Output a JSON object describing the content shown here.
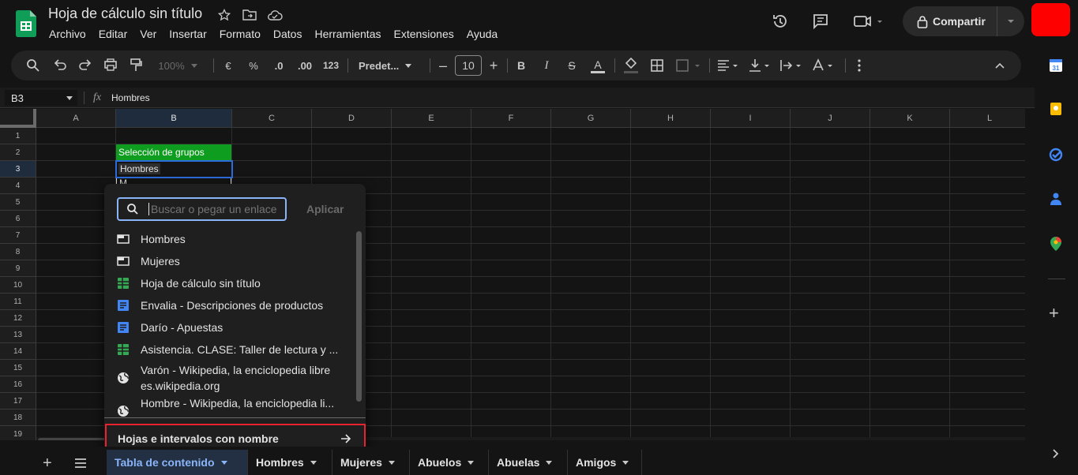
{
  "doc_title": "Hoja de cálculo sin título",
  "menu": [
    "Archivo",
    "Editar",
    "Ver",
    "Insertar",
    "Formato",
    "Datos",
    "Herramientas",
    "Extensiones",
    "Ayuda"
  ],
  "share_label": "Compartir",
  "toolbar": {
    "zoom": "100%",
    "currency": "€",
    "percent": "%",
    "dec_down": ".0",
    "dec_up": ".00",
    "num_format": "123",
    "font": "Predet...",
    "font_size": "10",
    "bold": "B",
    "italic": "I",
    "strike": "S",
    "text_color": "A"
  },
  "formula_bar": {
    "cell_ref": "B3",
    "fx": "fx",
    "value": "Hombres"
  },
  "columns": [
    "A",
    "B",
    "C",
    "D",
    "E",
    "F",
    "G",
    "H",
    "I",
    "J",
    "K",
    "L"
  ],
  "rows": [
    "1",
    "2",
    "3",
    "4",
    "5",
    "6",
    "7",
    "8",
    "9",
    "10",
    "11",
    "12",
    "13",
    "14",
    "15",
    "16",
    "17",
    "18",
    "19"
  ],
  "cells": {
    "b2": "Selección de grupos",
    "b3": "Hombres",
    "b4_partial": "M..."
  },
  "link_popup": {
    "search_placeholder": "Buscar o pegar un enlace",
    "apply_label": "Aplicar",
    "items": [
      {
        "label": "Hombres",
        "icon": "sheet-tab-icon"
      },
      {
        "label": "Mujeres",
        "icon": "sheet-tab-icon"
      },
      {
        "label": "Hoja de cálculo sin título",
        "icon": "sheets-file-icon"
      },
      {
        "label": "Envalia - Descripciones de productos",
        "icon": "docs-file-icon"
      },
      {
        "label": "Darío - Apuestas",
        "icon": "docs-file-icon"
      },
      {
        "label": "Asistencia. CLASE: Taller de lectura y ...",
        "icon": "sheets-file-icon"
      },
      {
        "label": "Varón - Wikipedia, la enciclopedia libre",
        "sub": "es.wikipedia.org",
        "icon": "globe-icon"
      },
      {
        "label": "Hombre - Wikipedia, la enciclopedia li...",
        "icon": "globe-icon"
      }
    ],
    "footer_label": "Hojas e intervalos con nombre"
  },
  "sheet_tabs": [
    "Tabla de contenido",
    "Hombres",
    "Mujeres",
    "Abuelos",
    "Abuelas",
    "Amigos"
  ],
  "colors": {
    "accent": "#8ab4f8",
    "green": "#0f9d58",
    "highlight": "#e8222e"
  }
}
